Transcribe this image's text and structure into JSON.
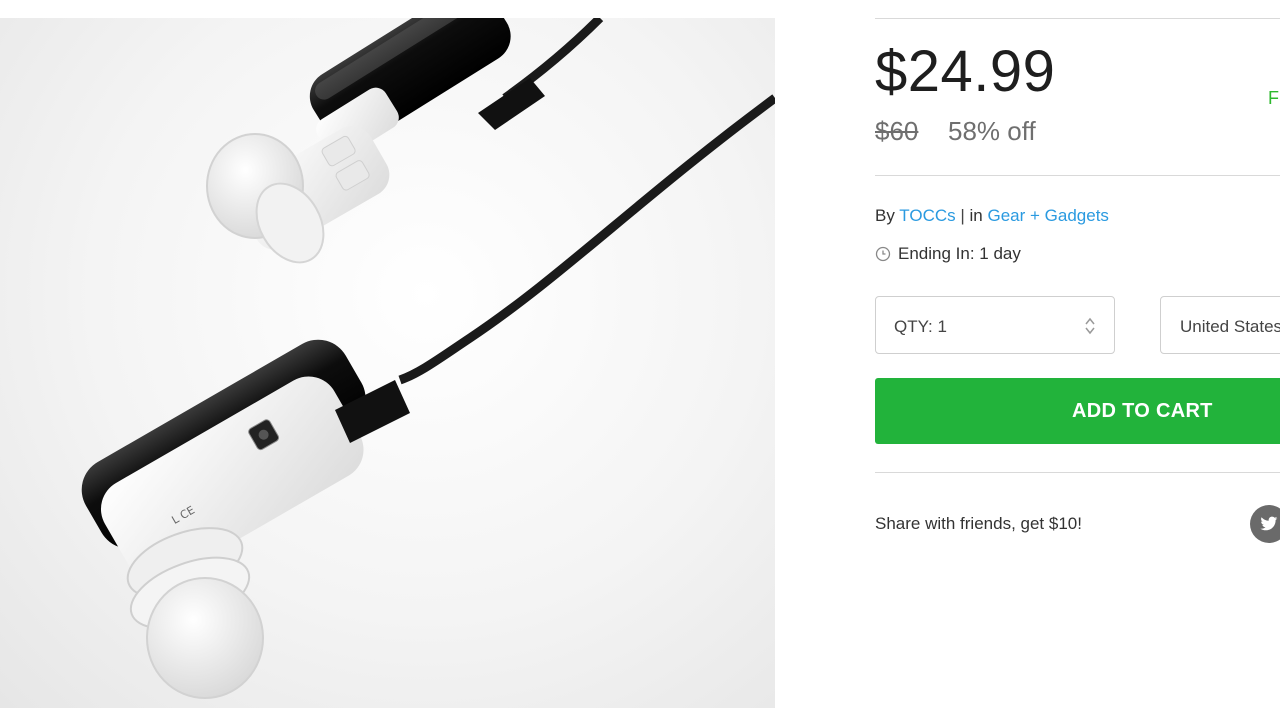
{
  "product": {
    "image_alt": "Bluetooth earbuds product photo"
  },
  "pricing": {
    "price": "$24.99",
    "original_price": "$60",
    "discount": "58% off",
    "shipping_partial": "Fr"
  },
  "byline": {
    "by_label": "By",
    "vendor": "TOCCs",
    "separator": "|",
    "in_label": "in",
    "category": "Gear + Gadgets"
  },
  "ending": {
    "text": "Ending In: 1 day"
  },
  "quantity": {
    "label": "QTY: 1"
  },
  "country": {
    "selected": "United States"
  },
  "cart": {
    "button_label": "ADD TO CART"
  },
  "share": {
    "text": "Share with friends, get $10!"
  },
  "colors": {
    "accent_green": "#22b33b",
    "link_blue": "#2a9ae0",
    "shipping_green": "#2eb82e"
  },
  "icons": {
    "clock": "clock-icon",
    "stepper": "stepper-icon",
    "twitter": "twitter-icon"
  }
}
